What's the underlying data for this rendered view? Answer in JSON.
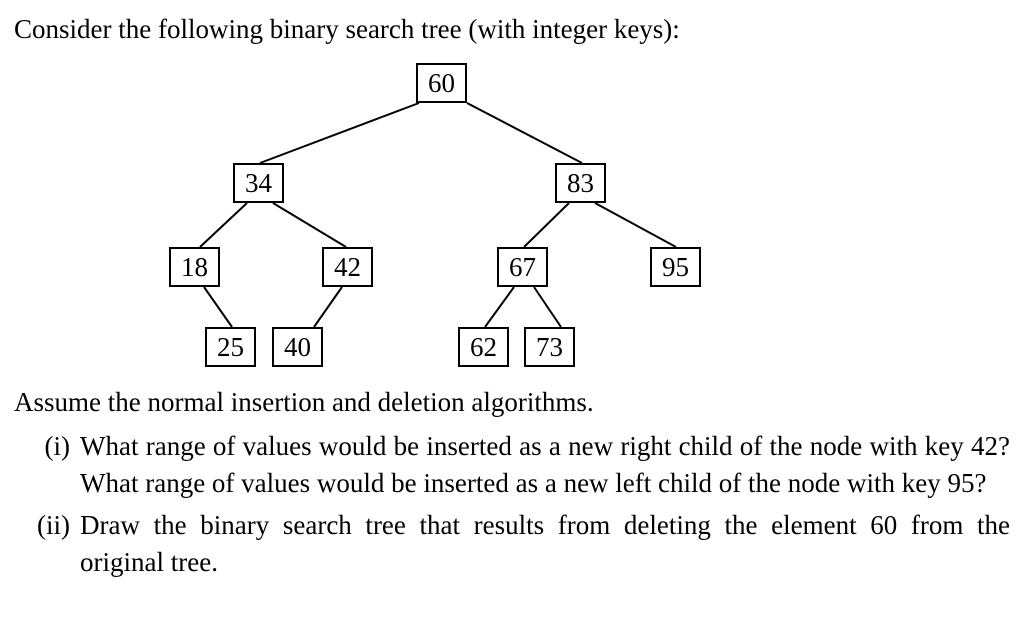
{
  "prompt": "Consider the following binary search tree (with integer keys):",
  "assumption": "Assume the normal insertion and deletion algorithms.",
  "questions": {
    "i": {
      "roman": "(i)",
      "text": "What range of values would be inserted as a new right child of the node with key 42? What range of values would be inserted as a new left child of the node with key 95?"
    },
    "ii": {
      "roman": "(ii)",
      "text": "Draw the binary search tree that results from deleting the element 60 from the original tree."
    }
  },
  "tree": {
    "root": "60",
    "left34": "34",
    "right83": "83",
    "n18": "18",
    "n42": "42",
    "n67": "67",
    "n95": "95",
    "n25": "25",
    "n40": "40",
    "n62": "62",
    "n73": "73"
  },
  "chart_data": {
    "type": "tree",
    "description": "Binary search tree with integer keys",
    "root": 60,
    "edges": [
      [
        60,
        34
      ],
      [
        60,
        83
      ],
      [
        34,
        18
      ],
      [
        34,
        42
      ],
      [
        83,
        67
      ],
      [
        83,
        95
      ],
      [
        18,
        25
      ],
      [
        42,
        40
      ],
      [
        67,
        62
      ],
      [
        67,
        73
      ]
    ],
    "nodes": [
      60,
      34,
      83,
      18,
      42,
      67,
      95,
      25,
      40,
      62,
      73
    ]
  }
}
